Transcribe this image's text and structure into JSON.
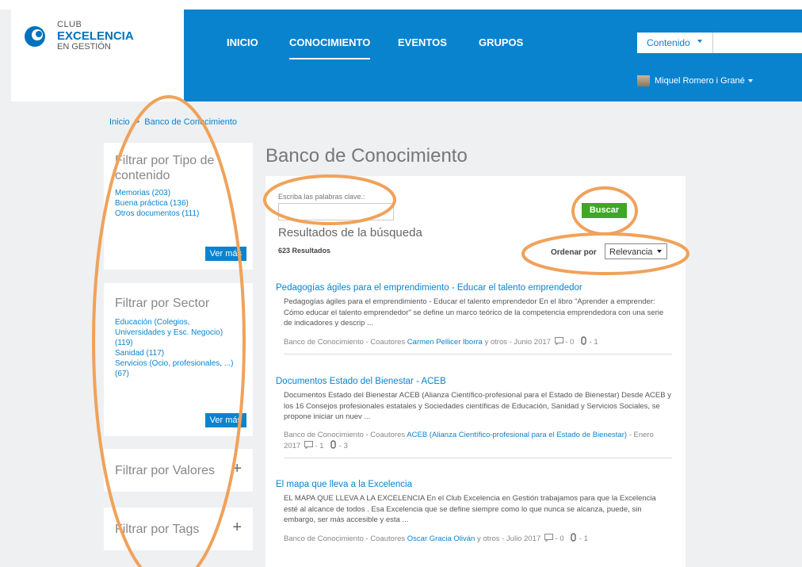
{
  "header": {
    "logo": {
      "club": "CLUB",
      "excelencia": "EXCELENCIA",
      "gestion": "EN GESTIÓN"
    },
    "nav": [
      {
        "label": "INICIO",
        "active": false
      },
      {
        "label": "CONOCIMIENTO",
        "active": true
      },
      {
        "label": "EVENTOS",
        "active": false
      },
      {
        "label": "GRUPOS",
        "active": false
      }
    ],
    "search_type": "Contenido",
    "user_name": "Miquel Romero i Grané"
  },
  "breadcrumb": {
    "home": "Inicio",
    "separator": ">",
    "current": "Banco de Conocimiento"
  },
  "filters": {
    "tipo": {
      "title": "Filtrar por Tipo de contenido",
      "items": [
        "Memorias (203)",
        "Buena práctica (136)",
        "Otros documentos (111)"
      ],
      "more": "Ver más"
    },
    "sector": {
      "title": "Filtrar por Sector",
      "items": [
        "Educación (Colegios, Universidades y Esc. Negocio) (119)",
        "Sanidad (117)",
        "Servicios (Ocio, profesionales, ...) (67)"
      ],
      "more": "Ver más"
    },
    "valores": {
      "title": "Filtrar por Valores",
      "toggle": "+"
    },
    "tags": {
      "title": "Filtrar por Tags",
      "toggle": "+"
    }
  },
  "main": {
    "title": "Banco de Conocimiento",
    "keyword_label": "Escriba las palabras clave.:",
    "keyword_value": "",
    "search_button": "Buscar",
    "results_title": "Resultados de la búsqueda",
    "results_count": "623 Resultados",
    "order_label": "Ordenar por",
    "order_value": "Relevancia"
  },
  "results": [
    {
      "title": "Pedagogías ágiles para el emprendimiento - Educar el talento emprendedor",
      "desc": "Pedagogías ágiles para el emprendimiento - Educar el talento emprendedor En el libro \"Aprender a emprender: Cómo educar el talento emprendedor\" se define un marco teórico de la competencia emprendedora con una serie de indicadores y descrip ...",
      "source": "Banco de Conocimiento - Coautores",
      "author": "Carmen Pellicer Iborra",
      "suffix": "y otros - Junio 2017",
      "comments": "- 0",
      "attachments": "- 1"
    },
    {
      "title": "Documentos Estado del Bienestar - ACEB",
      "desc": "Documentos Estado del Bienestar ACEB (Alianza Científico-profesional para el Estado de Bienestar) Desde ACEB y los 16 Consejos profesionales estatales y Sociedades científicas de Educación, Sanidad y Servicios Sociales, se propone iniciar un nuev ...",
      "source": "Banco de Conocimiento - Coautores",
      "author": "ACEB (Alianza Científico-profesional para el Estado de Bienestar)",
      "suffix": "- Enero 2017",
      "comments": "- 1",
      "attachments": "- 3"
    },
    {
      "title": "El mapa que lleva a la Excelencia",
      "desc": "EL MAPA QUE LLEVA A LA EXCELENCIA En el Club Excelencia en Gestión trabajamos para que la Excelencia esté al alcance de todos . Esa Excelencia que se define siempre como lo que nunca se alcanza, puede, sin embargo, ser más accesible y esta ...",
      "source": "Banco de Conocimiento - Coautores",
      "author": "Oscar Gracia Oliván",
      "suffix": "y otros - Julio 2017",
      "comments": "- 0",
      "attachments": "- 1"
    }
  ],
  "colors": {
    "brand_blue": "#0a83cf",
    "button_green": "#3ea726",
    "annotation_orange": "#f0a25a"
  }
}
